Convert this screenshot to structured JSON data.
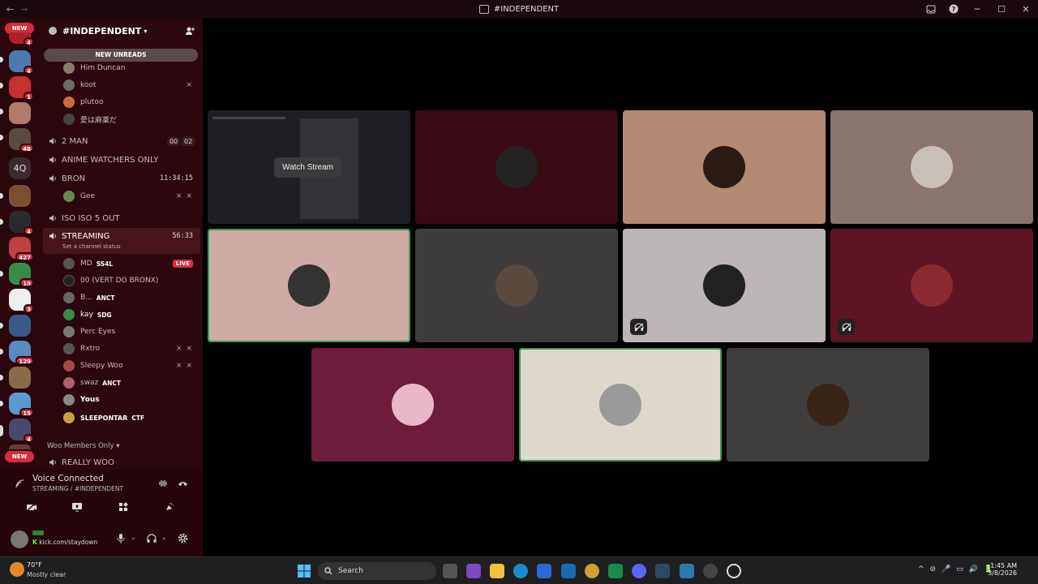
{
  "titlebar": {
    "title": "#INDEPENDENT",
    "back": "←",
    "forward": "→",
    "help": "?",
    "minimize": "─",
    "maximize": "☐",
    "close": "✕"
  },
  "rail": {
    "new_top": "NEW",
    "new_bottom": "NEW",
    "badges": [
      "4",
      "4",
      "1",
      "48",
      "4",
      "427",
      "19",
      "3",
      "129",
      "15",
      "4"
    ],
    "text_server": "4Q"
  },
  "sidebar": {
    "guild_name": "#INDEPENDENT",
    "new_unreads": "NEW UNREADS",
    "top_members": [
      {
        "name": "Him Duncan",
        "color": "#8a7a6e"
      },
      {
        "name": "koot",
        "color": "#6b6b6b",
        "muted": true
      },
      {
        "name": "plutoo",
        "color": "#d06a3a"
      },
      {
        "name": "愛は麻薬だ",
        "color": "#444"
      }
    ],
    "channels": [
      {
        "name": "2 MAN",
        "counts": [
          "00",
          "02"
        ]
      },
      {
        "name": "ANIME WATCHERS ONLY"
      },
      {
        "name": "BRON",
        "timer": "11:34:15",
        "member": "Gee"
      },
      {
        "name": "ISO ISO 5 OUT"
      },
      {
        "name": "STREAMING",
        "timer": "56:33",
        "status": "Set a channel status"
      }
    ],
    "stream_members": [
      {
        "name": "MD",
        "tag": "SS4L",
        "live": "LIVE",
        "color": "#555"
      },
      {
        "name": "00 (VERT DO BRONX)",
        "color": "#222"
      },
      {
        "name": "B...",
        "tag": "ANCT",
        "color": "#666"
      },
      {
        "name": "kay",
        "tag": "SDG",
        "color": "#3a8a4a"
      },
      {
        "name": "Perc Eyes",
        "color": "#777"
      },
      {
        "name": "Rxtro",
        "color": "#555",
        "muted": true
      },
      {
        "name": "Sleepy Woo",
        "color": "#a04a4a",
        "muted": true
      },
      {
        "name": "swaz",
        "tag": "ANCT",
        "color": "#b06070"
      },
      {
        "name": "Yous",
        "color": "#888",
        "bold": true
      },
      {
        "name": "SLEEPONTAR",
        "tag": "CTF",
        "color": "#c8a040",
        "bold": true
      }
    ],
    "category": "Woo Members Only",
    "last_channel": "REALLY WOO",
    "muted_glyph": "⨯ ⨯"
  },
  "voice": {
    "status": "Voice Connected",
    "location": "STREAMING / #INDEPENDENT"
  },
  "user": {
    "status_text": "kick.com/staydown"
  },
  "stage": {
    "watch_stream": "Watch Stream",
    "tiles": [
      {
        "bg": "#1e1e24",
        "avatar": "#333",
        "stream": true
      },
      {
        "bg": "#3a0a14",
        "avatar": "#222"
      },
      {
        "bg": "#b58a72",
        "avatar": "#2a1a14"
      },
      {
        "bg": "#8a766e",
        "avatar": "#c8c0b8"
      },
      {
        "bg": "#cfaaa6",
        "avatar": "#333",
        "speaking": true
      },
      {
        "bg": "#3e3c3d",
        "avatar": "#5a4a40"
      },
      {
        "bg": "#bcb6b6",
        "avatar": "#222",
        "muted": true
      },
      {
        "bg": "#5e1424",
        "avatar": "#8a2a30",
        "muted": true
      },
      {
        "bg": "#6e1c3c",
        "avatar": "#e8b8c8"
      },
      {
        "bg": "#ded8cc",
        "avatar": "#9a9a9a",
        "speaking": true
      },
      {
        "bg": "#403e3c",
        "avatar": "#3a2418"
      }
    ]
  },
  "taskbar": {
    "temp": "70°F",
    "condition": "Mostly clear",
    "search": "Search",
    "time": "1:45 AM",
    "date": "3/8/2026",
    "tray": [
      "^",
      "⊘",
      "🎤",
      "▭",
      "🔊",
      "🔋"
    ]
  }
}
